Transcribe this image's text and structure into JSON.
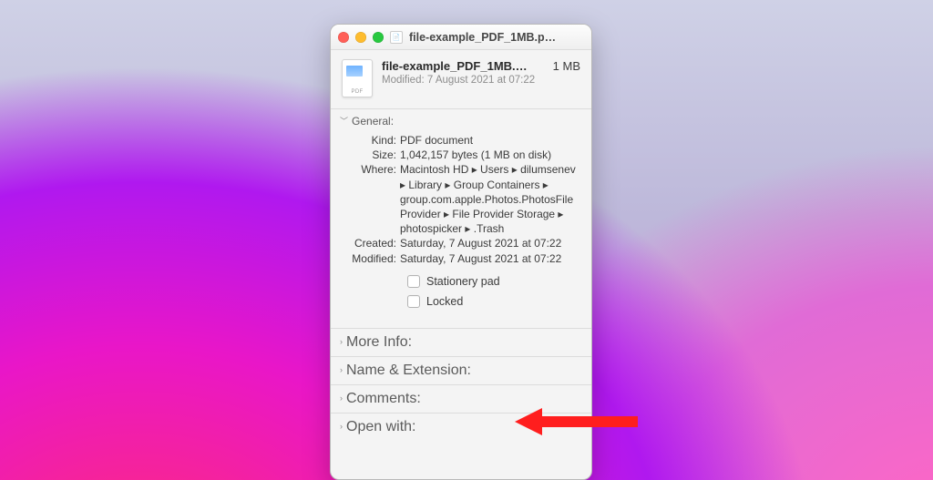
{
  "window": {
    "title": "file-example_PDF_1MB.p…"
  },
  "header": {
    "file_name": "file-example_PDF_1MB.…",
    "file_size": "1 MB",
    "modified_line": "Modified: 7 August 2021 at 07:22"
  },
  "sections": {
    "general": {
      "label": "General:",
      "rows": {
        "kind_label": "Kind:",
        "kind_value": "PDF document",
        "size_label": "Size:",
        "size_value": "1,042,157 bytes (1 MB on disk)",
        "where_label": "Where:",
        "where_value": "Macintosh HD ▸ Users ▸ dilumsenev ▸ Library ▸ Group Containers ▸ group.com.apple.Photos.PhotosFileProvider ▸ File Provider Storage ▸ photospicker ▸ .Trash",
        "created_label": "Created:",
        "created_value": "Saturday, 7 August 2021 at 07:22",
        "modified_label": "Modified:",
        "modified_value": "Saturday, 7 August 2021 at 07:22"
      },
      "checks": {
        "stationery": "Stationery pad",
        "locked": "Locked"
      }
    },
    "more_info": "More Info:",
    "name_ext": "Name & Extension:",
    "comments": "Comments:",
    "open_with": "Open with:"
  }
}
